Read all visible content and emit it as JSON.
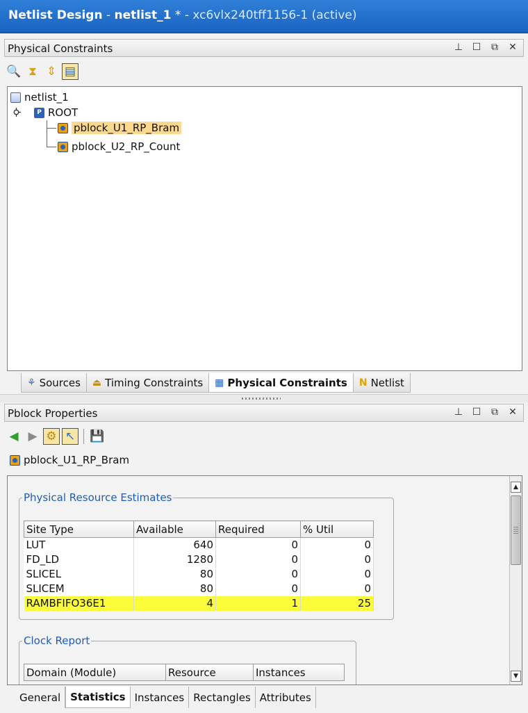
{
  "window": {
    "title_bold": "Netlist Design",
    "title_sep1": " - ",
    "title_file": "netlist_1",
    "title_mod": " *",
    "title_sep2": " - ",
    "title_device": "xc6vlx240tff1156-1 (active)"
  },
  "physical_constraints": {
    "title": "Physical Constraints",
    "tree": {
      "netlist": "netlist_1",
      "root": "ROOT",
      "pblocks": [
        "pblock_U1_RP_Bram",
        "pblock_U2_RP_Count"
      ]
    }
  },
  "top_tabs": {
    "sources": "Sources",
    "timing": "Timing Constraints",
    "physical": "Physical Constraints",
    "netlist": "Netlist"
  },
  "pblock_properties": {
    "title": "Pblock Properties",
    "selected": "pblock_U1_RP_Bram",
    "estimates": {
      "legend": "Physical Resource Estimates",
      "headers": [
        "Site Type",
        "Available",
        "Required",
        "% Util"
      ],
      "rows": [
        [
          "LUT",
          "640",
          "0",
          "0"
        ],
        [
          "FD_LD",
          "1280",
          "0",
          "0"
        ],
        [
          "SLICEL",
          "80",
          "0",
          "0"
        ],
        [
          "SLICEM",
          "80",
          "0",
          "0"
        ],
        [
          "RAMBFIFO36E1",
          "4",
          "1",
          "25"
        ]
      ]
    },
    "clock": {
      "legend": "Clock Report",
      "headers": [
        "Domain (Module)",
        "Resource",
        "Instances"
      ]
    },
    "tabs": [
      "General",
      "Statistics",
      "Instances",
      "Rectangles",
      "Attributes"
    ]
  },
  "colors": {
    "titlebar": "#1f6ac9",
    "selection": "#fcd98e",
    "highlight_row": "#fbfd3a",
    "legend_text": "#1f5db4"
  }
}
